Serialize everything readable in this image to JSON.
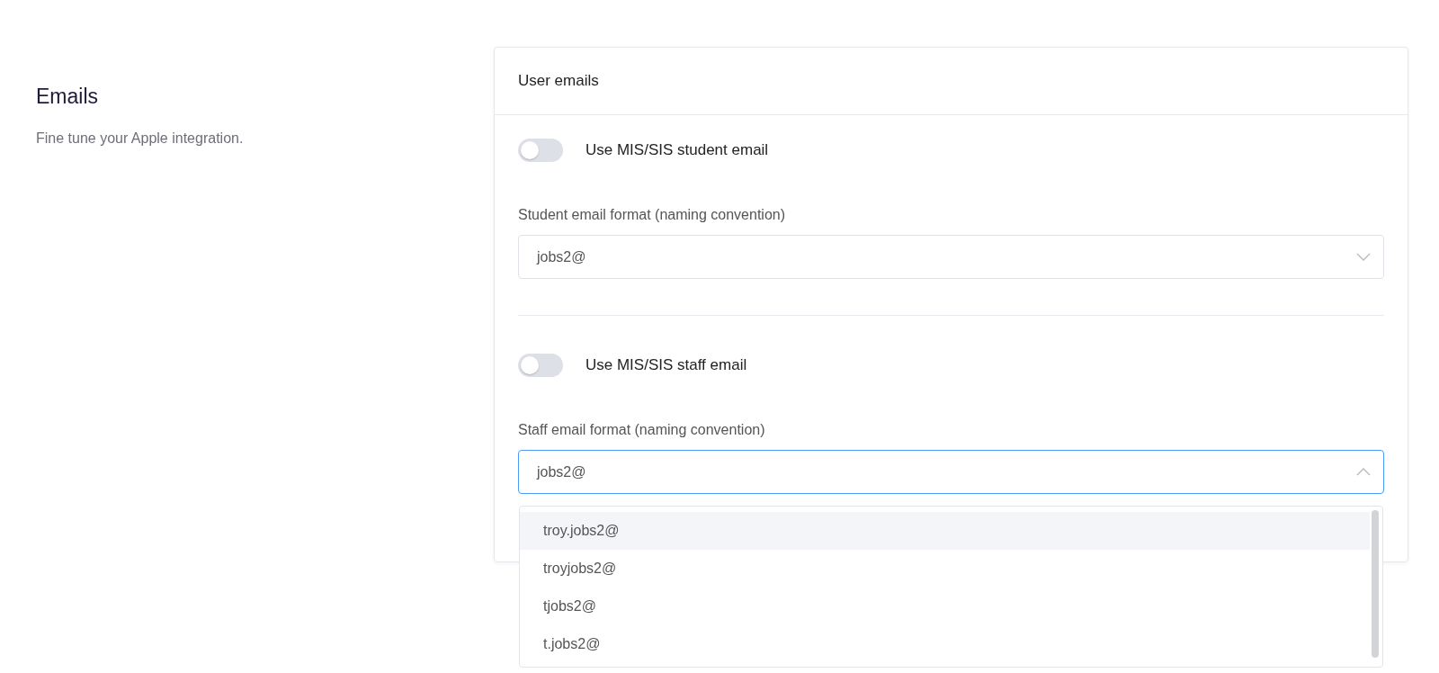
{
  "intro": {
    "title": "Emails",
    "subtitle": "Fine tune your Apple integration."
  },
  "card": {
    "title": "User emails",
    "sections": [
      {
        "toggle": {
          "label": "Use MIS/SIS student email",
          "on": false
        },
        "field": {
          "label": "Student email format (naming convention)",
          "value": "jobs2@",
          "open": false
        }
      },
      {
        "toggle": {
          "label": "Use MIS/SIS staff email",
          "on": false
        },
        "field": {
          "label": "Staff email format (naming convention)",
          "value": "jobs2@",
          "open": true,
          "options": [
            {
              "label": "troy.jobs2@",
              "selected": true
            },
            {
              "label": "troyjobs2@",
              "selected": false
            },
            {
              "label": "tjobs2@",
              "selected": false
            },
            {
              "label": "t.jobs2@",
              "selected": false
            }
          ]
        }
      }
    ]
  }
}
